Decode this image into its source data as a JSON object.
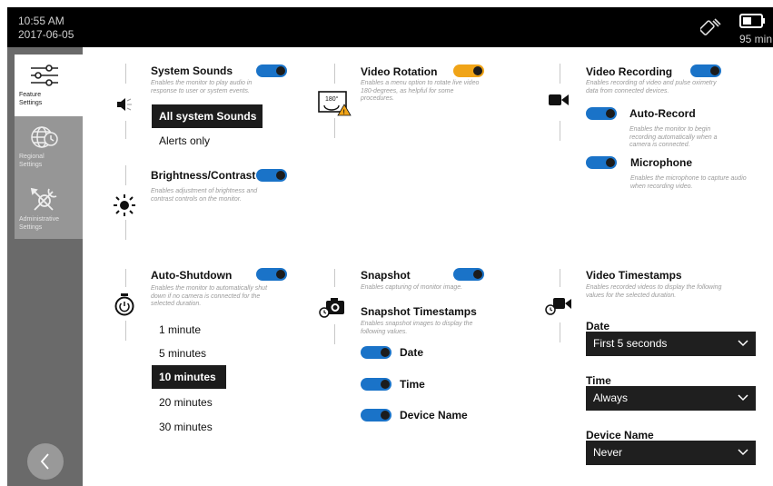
{
  "status": {
    "time": "10:55 AM",
    "date": "2017-06-05",
    "battery": "95 min"
  },
  "nav": [
    {
      "label": "Feature Settings",
      "icon": "sliders-icon"
    },
    {
      "label": "Regional Settings",
      "icon": "globe-clock-icon"
    },
    {
      "label": "Administrative Settings",
      "icon": "wrench-screwdriver-icon"
    }
  ],
  "system_sounds": {
    "title": "System Sounds",
    "desc": "Enables the monitor to play audio in response to user or system events.",
    "options": [
      "All system Sounds",
      "Alerts only"
    ],
    "selected": "All system Sounds",
    "enabled": true
  },
  "brightness": {
    "title": "Brightness/Contrast",
    "desc": "Enables adjustment of brightness and contrast controls on the monitor.",
    "enabled": true
  },
  "video_rotation": {
    "title": "Video Rotation",
    "desc": "Enables a menu option to rotate live video 180-degrees, as helpful for some procedures.",
    "enabled": true,
    "accent": "#f0a418"
  },
  "video_recording": {
    "title": "Video Recording",
    "desc": "Enables recording of video and pulse oximetry data from connected devices.",
    "enabled": true,
    "auto_record": {
      "title": "Auto-Record",
      "desc": "Enables the monitor to begin recording automatically when a camera is connected.",
      "enabled": true
    },
    "microphone": {
      "title": "Microphone",
      "desc": "Enables the microphone to capture audio when recording video.",
      "enabled": true
    }
  },
  "auto_shutdown": {
    "title": "Auto-Shutdown",
    "desc": "Enables the monitor to automatically shut down if no camera is connected for the selected duration.",
    "enabled": true,
    "options": [
      "1 minute",
      "5 minutes",
      "10 minutes",
      "20 minutes",
      "30 minutes"
    ],
    "selected": "10 minutes"
  },
  "snapshot": {
    "title": "Snapshot",
    "desc": "Enables capturing of monitor image.",
    "enabled": true,
    "timestamps_title": "Snapshot Timestamps",
    "timestamps_desc": "Enables snapshot images to display the following values.",
    "items": [
      {
        "label": "Date",
        "enabled": true
      },
      {
        "label": "Time",
        "enabled": true
      },
      {
        "label": "Device Name",
        "enabled": true
      }
    ]
  },
  "video_timestamps": {
    "title": "Video Timestamps",
    "desc": "Enables recorded videos to display the following values for the selected duration.",
    "fields": [
      {
        "label": "Date",
        "value": "First 5 seconds"
      },
      {
        "label": "Time",
        "value": "Always"
      },
      {
        "label": "Device Name",
        "value": "Never"
      }
    ]
  },
  "colors": {
    "toggle_on": "#1a73c8",
    "toggle_orange": "#f0a418",
    "sidebar": "#6a6a6a",
    "selected_bg": "#1c1c1c"
  }
}
